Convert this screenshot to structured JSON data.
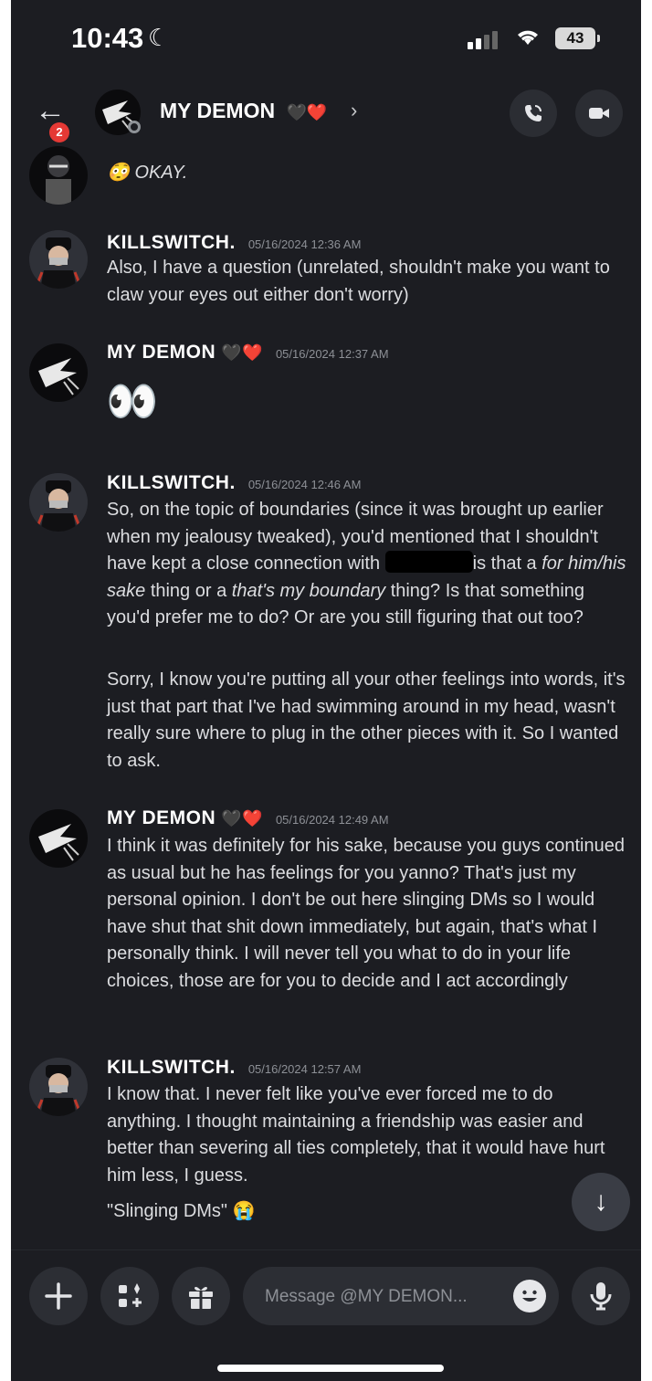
{
  "status_bar": {
    "time": "10:43",
    "battery": "43"
  },
  "header": {
    "unread_count": "2",
    "title": "MY DEMON",
    "title_emoji": "🖤❤️",
    "chevron": "›"
  },
  "top_fragment": {
    "emoji": "😳",
    "text": "OKAY."
  },
  "messages": [
    {
      "author": "KILLSWITCH.",
      "timestamp": "05/16/2024 12:36 AM",
      "paragraphs": [
        "Also, I have a question (unrelated, shouldn't make you want to claw your eyes out either don't worry)"
      ]
    },
    {
      "author": "MY DEMON",
      "author_emoji": "🖤❤️",
      "timestamp": "05/16/2024 12:37 AM",
      "content_emoji": "👀"
    },
    {
      "author": "KILLSWITCH.",
      "timestamp": "05/16/2024 12:46 AM",
      "p1_a": "So, on the topic of boundaries (since it was brought up earlier when my jealousy tweaked), you'd mentioned that I shouldn't have kept a close connection with",
      "p1_b": "is that a",
      "p1_em1": "for him/his sake",
      "p1_c": "thing or a",
      "p1_em2": "that's my boundary",
      "p1_d": "thing? Is that something you'd prefer me to do? Or are you still figuring that out too?",
      "p2": "Sorry, I know you're putting all your other feelings into words, it's just that part that I've had swimming around in my head, wasn't really sure where to plug in the other pieces with it. So I wanted to ask."
    },
    {
      "author": "MY DEMON",
      "author_emoji": "🖤❤️",
      "timestamp": "05/16/2024 12:49 AM",
      "paragraphs": [
        "I think it was definitely for his sake, because you guys continued as usual but he has feelings for you yanno? That's just my personal opinion. I don't be out here slinging DMs so I would have shut that shit down immediately, but again, that's what I personally think. I will never tell you what to do in your life choices, those are for you to decide and I act accordingly"
      ]
    },
    {
      "author": "KILLSWITCH.",
      "timestamp": "05/16/2024 12:57 AM",
      "paragraphs": [
        "I know that. I never felt like you've ever forced me to do anything. I thought maintaining a friendship was easier and better than severing all ties completely, that it would have hurt him less, I guess."
      ],
      "quote": "\"Slinging DMs\"",
      "quote_emoji": "😭"
    }
  ],
  "composer": {
    "placeholder": "Message @MY DEMON..."
  },
  "icons": [
    "back-arrow-icon",
    "phone-call-icon",
    "video-camera-icon",
    "plus-icon",
    "apps-icon",
    "gift-icon",
    "emoji-icon",
    "microphone-icon",
    "arrow-down-icon"
  ]
}
